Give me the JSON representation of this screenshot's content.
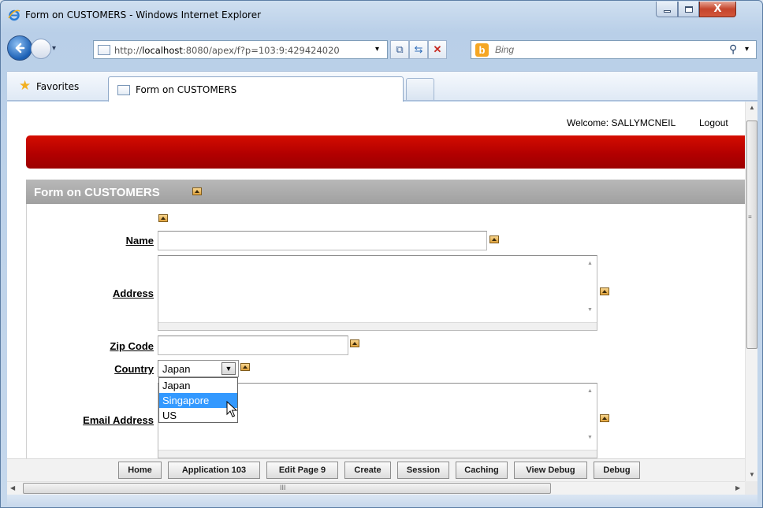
{
  "window": {
    "title": "Form on CUSTOMERS - Windows Internet Explorer",
    "controls": {
      "minimize": "—",
      "maximize": "☐",
      "close": "X"
    }
  },
  "navbar": {
    "address_prefix": "http://",
    "address_host": "localhost",
    "address_rest": ":8080/apex/f?p=103:9:429424020",
    "search_engine": "Bing",
    "search_placeholder": "Bing",
    "back_icon": "back-arrow-icon",
    "refresh_icon": "refresh-icon",
    "stop_icon": "stop-icon",
    "compat_icon": "compatibility-view-icon",
    "dropdown_glyph": "▾"
  },
  "favorites_bar": {
    "favorites_label": "Favorites",
    "tab_label": "Form on CUSTOMERS"
  },
  "page": {
    "welcome": "Welcome: SALLYMCNEIL",
    "logout": "Logout",
    "region_title": "Form on CUSTOMERS",
    "brand_color": "#c00000",
    "fields": {
      "name_label": "Name",
      "name_value": "",
      "address_label": "Address",
      "address_value": "",
      "zip_label": "Zip Code",
      "zip_value": "",
      "country_label": "Country",
      "country_value": "Japan",
      "email_label": "Email Address",
      "email_value": ""
    },
    "country_options": [
      "Japan",
      "Singapore",
      "US"
    ],
    "country_highlighted": "Singapore"
  },
  "dev_toolbar": {
    "buttons": [
      "Home",
      "Application 103",
      "Edit Page 9",
      "Create",
      "Session",
      "Caching",
      "View Debug",
      "Debug"
    ]
  },
  "scrollbars": {
    "horizontal_grip": "III",
    "vertical_grip": "≡"
  }
}
